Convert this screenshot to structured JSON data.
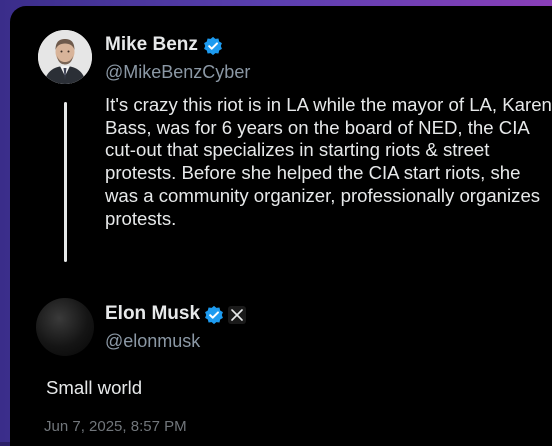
{
  "original_tweet": {
    "author_name": "Mike Benz",
    "author_handle": "@MikeBenzCyber",
    "verified_icon": "verified-badge-icon",
    "text": "It's crazy this riot is in LA while the mayor of LA, Karen Bass, was for 6 years on the board of NED, the CIA cut-out that specializes in starting riots & street protests. Before she helped the CIA start riots, she was a community organizer, professionally organizes protests."
  },
  "reply": {
    "author_name": "Elon Musk",
    "author_handle": "@elonmusk",
    "verified_icon": "verified-badge-icon",
    "affiliation_icon": "x-logo-icon",
    "text": "Small world",
    "timestamp": "Jun 7, 2025, 8:57 PM"
  },
  "colors": {
    "background": "#000000",
    "text_primary": "#e7e9ea",
    "text_secondary": "#8b98a5",
    "verified_blue": "#1d9bf0",
    "frame_gradient": [
      "#3a2d8a",
      "#8a3fb8"
    ]
  }
}
